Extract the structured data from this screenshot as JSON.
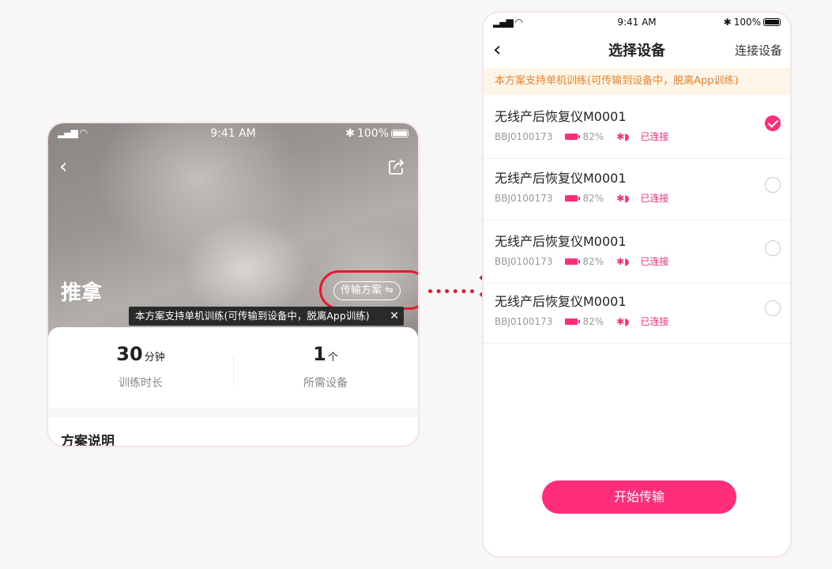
{
  "left_screen": {
    "status": {
      "signal": "▂▄▆ ◠",
      "time": "9:41 AM",
      "battery": "100%"
    },
    "title": "推拿",
    "transfer_button": "传输方案 ⇋",
    "tooltip": "本方案支持单机训练(可传输到设备中，脱离App训练)",
    "tooltip_close": "✕",
    "stats": [
      {
        "value": "30",
        "unit": "分钟",
        "label": "训练时长"
      },
      {
        "value": "1",
        "unit": "个",
        "label": "所需设备"
      }
    ],
    "section_title": "方案说明"
  },
  "right_screen": {
    "status": {
      "signal": "▂▄▆ ◠",
      "time": "9:41 AM",
      "battery": "100%"
    },
    "title": "选择设备",
    "action": "连接设备",
    "notice": "本方案支持单机训练(可传输到设备中，脱离App训练)",
    "devices": [
      {
        "name": "无线产后恢复仪M0001",
        "serial": "BBJ0100173",
        "battery": "82%",
        "status": "已连接",
        "selected": true
      },
      {
        "name": "无线产后恢复仪M0001",
        "serial": "BBJ0100173",
        "battery": "82%",
        "status": "已连接",
        "selected": false
      },
      {
        "name": "无线产后恢复仪M0001",
        "serial": "BBJ0100173",
        "battery": "82%",
        "status": "已连接",
        "selected": false
      },
      {
        "name": "无线产后恢复仪M0001",
        "serial": "BBJ0100173",
        "battery": "82%",
        "status": "已连接",
        "selected": false
      }
    ],
    "start_button": "开始传输"
  },
  "colors": {
    "accent": "#ff2d7a",
    "notice_text": "#f2822c",
    "highlight": "#e8192c"
  }
}
